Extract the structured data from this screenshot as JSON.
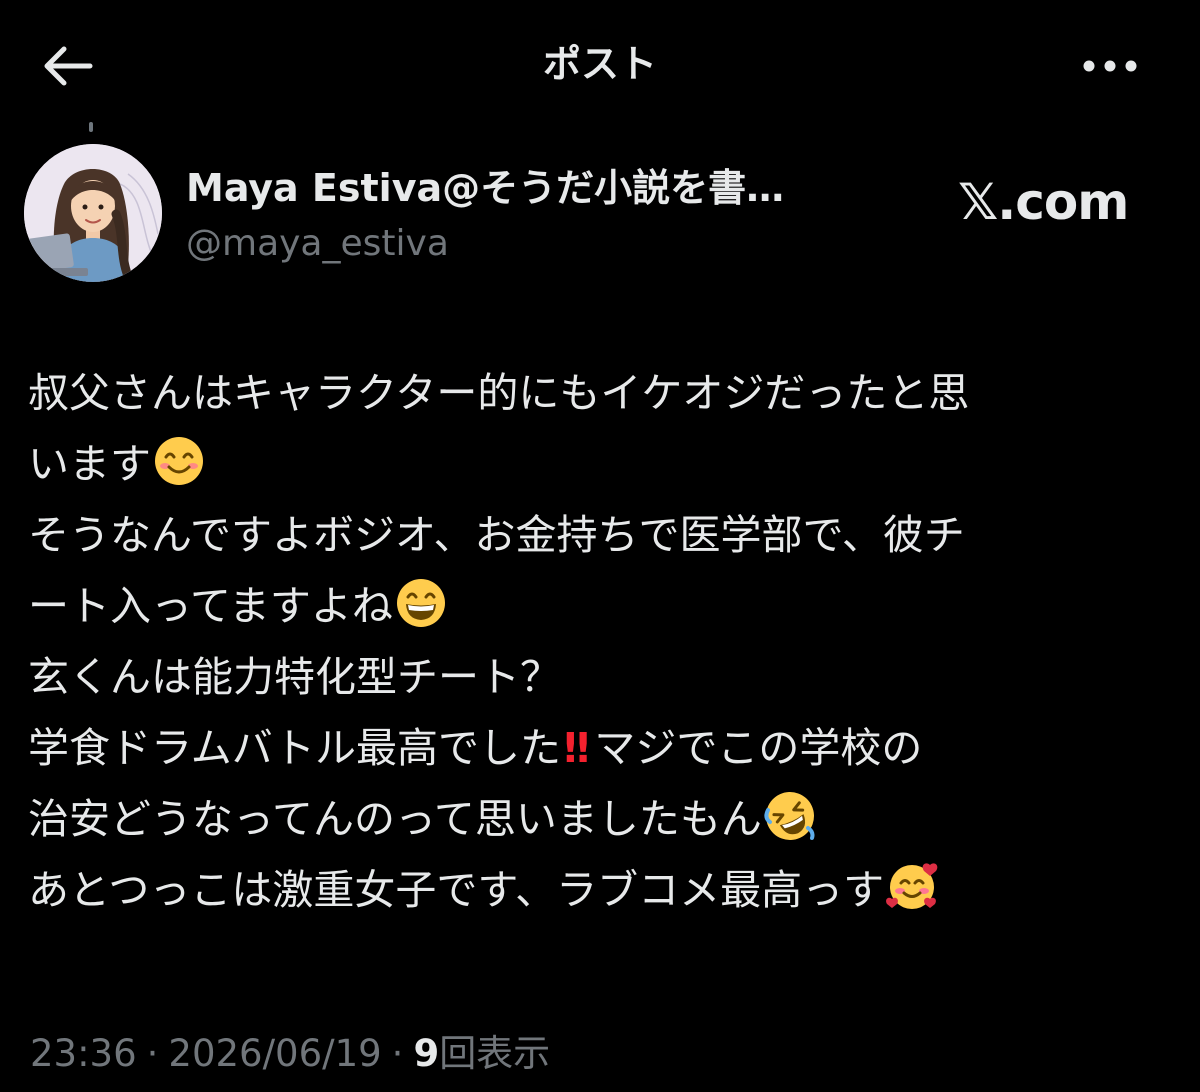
{
  "header": {
    "title": "ポスト",
    "back_icon": "arrow-left-icon",
    "more_icon": "more-horizontal-icon"
  },
  "author": {
    "display_name": "Maya Estiva@そうだ小説を書…",
    "handle": "@maya_estiva",
    "avatar": "avatar-illustration"
  },
  "watermark": {
    "text": "𝕏.com"
  },
  "tweet": {
    "lines": [
      {
        "text": "叔父さんはキャラクター的にもイケオジだったと思",
        "emoji": ""
      },
      {
        "text": "います",
        "emoji": "smiling-face-icon"
      },
      {
        "text": "そうなんですよボジオ、お金持ちで医学部で、彼チ",
        "emoji": ""
      },
      {
        "text": "ート入ってますよね",
        "emoji": "grinning-face-icon"
      },
      {
        "text": "玄くんは能力特化型チート？",
        "emoji": ""
      },
      {
        "text": "学食ドラムバトル最高でした",
        "bang": "!!",
        "tail": "マジでこの学校の"
      },
      {
        "text": "治安どうなってんのって思いましたもん",
        "emoji": "rolling-laughing-face-icon"
      },
      {
        "text": "あとつっこは激重女子です、ラブコメ最高っす",
        "emoji": "smiling-face-with-hearts-icon"
      }
    ]
  },
  "meta": {
    "time": "23:36",
    "separator": "·",
    "date": "2026/06/19",
    "views_count": "9",
    "views_label": "回表示"
  },
  "colors": {
    "background": "#000000",
    "text_primary": "#e7e9ea",
    "text_secondary": "#71767b",
    "bang_red": "#f4212e",
    "emoji_yellow": "#ffcc4d"
  }
}
